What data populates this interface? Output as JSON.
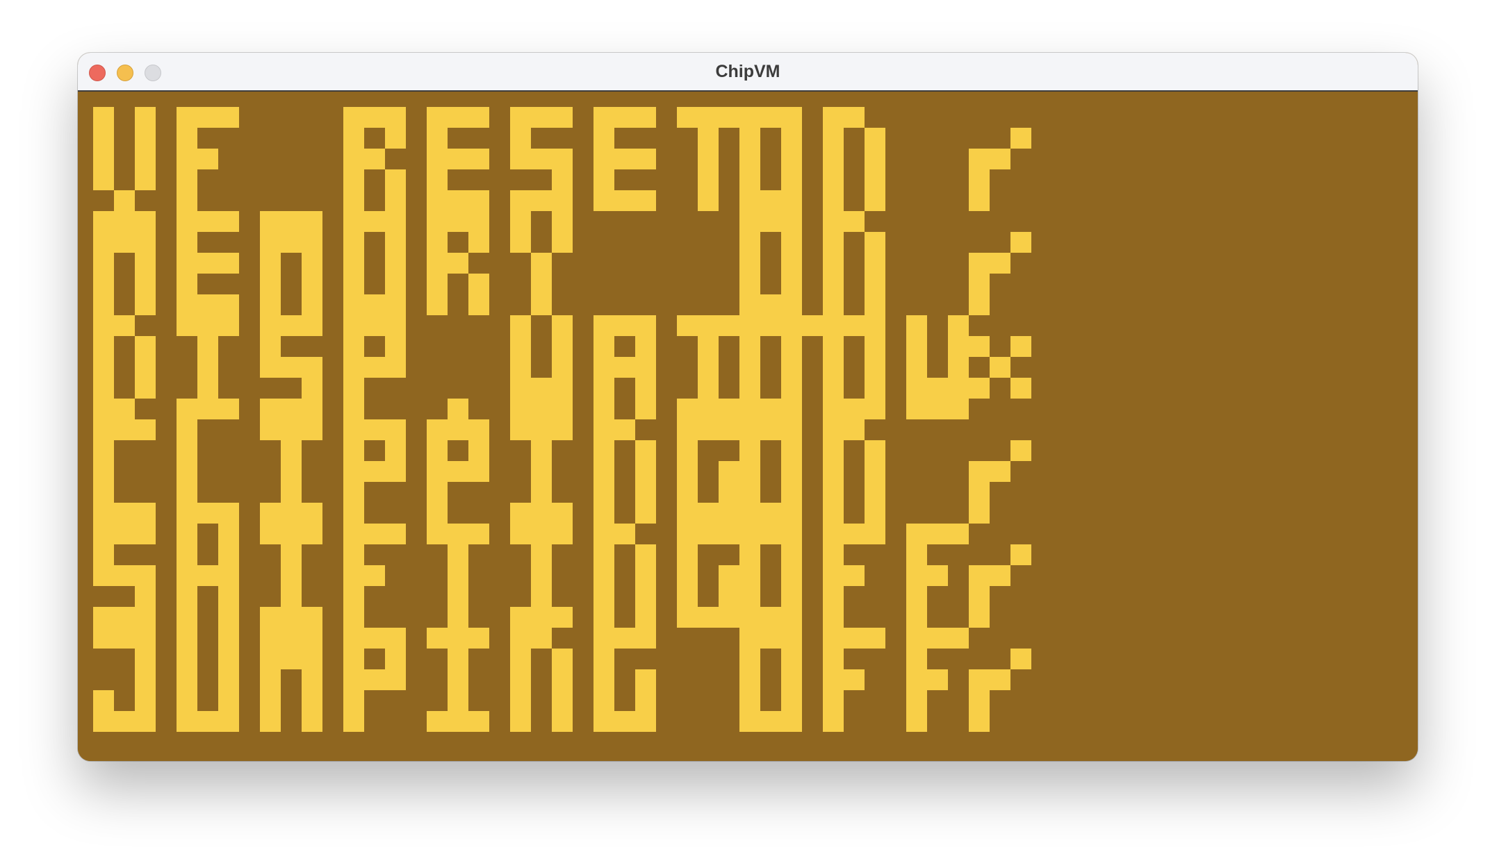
{
  "window": {
    "title": "ChipVM"
  },
  "colors": {
    "background": "#8f6620",
    "foreground": "#f8cf48"
  },
  "quirks": [
    {
      "label": "VF RESET",
      "state": "ON",
      "result": "check"
    },
    {
      "label": "MEMORY",
      "state": "ON",
      "result": "check"
    },
    {
      "label": "DISP.WAIT",
      "state": "LOW",
      "result": "cross"
    },
    {
      "label": "CLIPPING",
      "state": "ON",
      "result": "check"
    },
    {
      "label": "SHIFTING",
      "state": "OFF",
      "result": "check"
    },
    {
      "label": "JUMPING",
      "state": "OFF",
      "result": "check"
    }
  ]
}
